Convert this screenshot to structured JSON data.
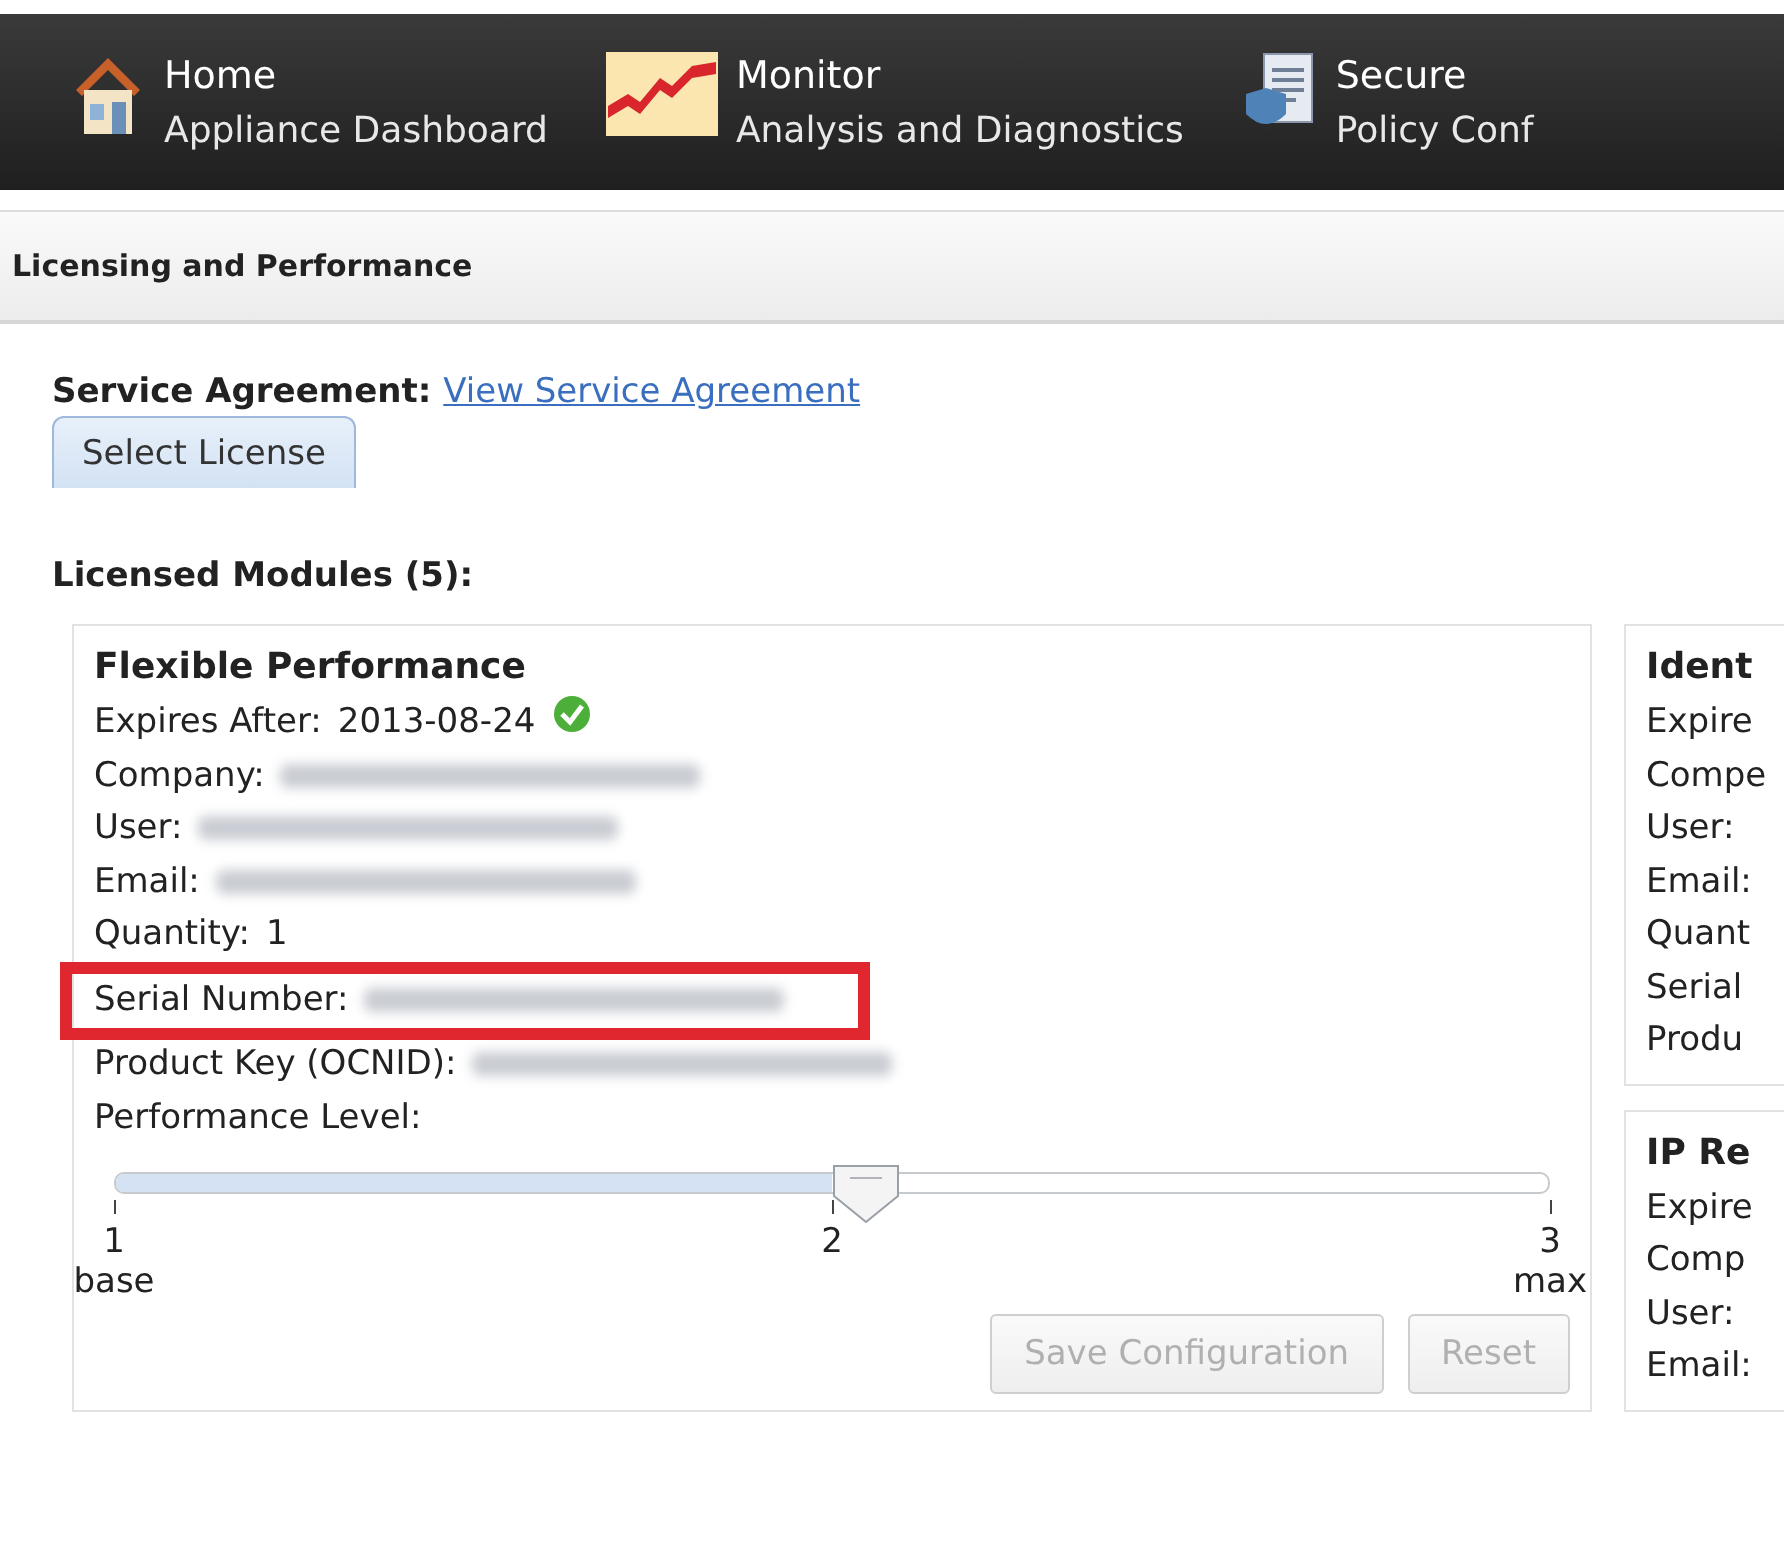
{
  "nav": [
    {
      "kind": "house",
      "title": "Home",
      "subtitle": "Appliance Dashboard"
    },
    {
      "kind": "chart",
      "title": "Monitor",
      "subtitle": "Analysis and Diagnostics"
    },
    {
      "kind": "policy",
      "title": "Secure",
      "subtitle": "Policy Conf"
    }
  ],
  "page_title": "Licensing and Performance",
  "service_agreement": {
    "label": "Service Agreement:",
    "link": "View Service Agreement"
  },
  "tabs": [
    {
      "label": "Select License",
      "selected": true
    }
  ],
  "modules_heading": "Licensed Modules (5):",
  "main_module": {
    "title": "Flexible Performance",
    "fields": [
      {
        "label": "Expires After:",
        "value": "2013-08-24",
        "redacted": false,
        "valid": true
      },
      {
        "label": "Company:",
        "redacted": true
      },
      {
        "label": "User:",
        "redacted": true
      },
      {
        "label": "Email:",
        "redacted": true
      },
      {
        "label": "Quantity:",
        "value": "1",
        "redacted": false
      },
      {
        "label": "Serial Number:",
        "redacted": true,
        "highlighted": true
      },
      {
        "label": "Product Key (OCNID):",
        "redacted": true
      }
    ],
    "slider": {
      "label": "Performance Level:",
      "level": 0.5,
      "ticks": [
        {
          "number": "1",
          "caption": "base"
        },
        {
          "number": "2"
        },
        {
          "number": "3",
          "caption": "max"
        }
      ]
    },
    "buttons": [
      {
        "label": "Save Configuration",
        "disabled": true
      },
      {
        "label": "Reset",
        "disabled": true
      }
    ]
  },
  "side_modules": [
    {
      "title": "Ident",
      "fields": [
        "Expire",
        "Compe",
        "User:",
        "Email:",
        "Quant",
        "Serial",
        "Produ"
      ]
    },
    {
      "title": "IP Re",
      "fields": [
        "Expire",
        "Comp",
        "User:",
        "Email:"
      ]
    }
  ]
}
